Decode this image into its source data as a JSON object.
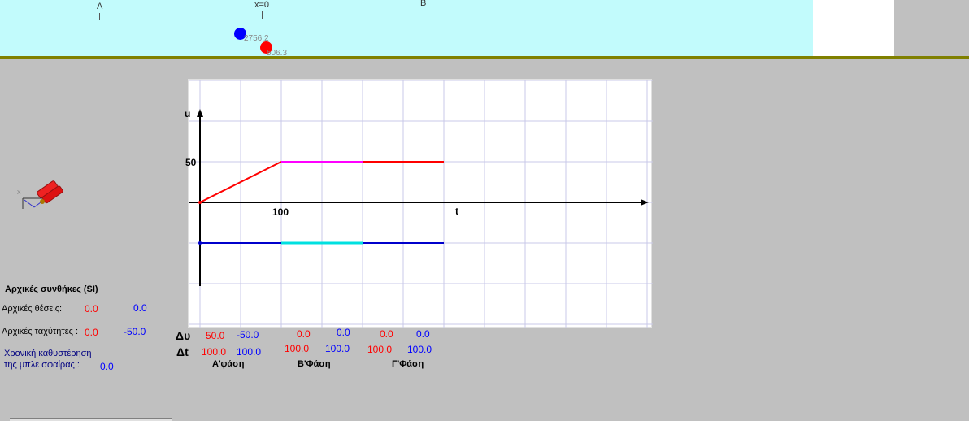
{
  "track": {
    "marker_a": "A",
    "marker_origin": "x=0",
    "marker_b": "B",
    "blue_ball_label": "2756.2",
    "red_ball_label": "506.3",
    "colors": {
      "track": "#c2fbfc",
      "ground": "#808000",
      "blue": "#0000ff",
      "red": "#ff0000"
    }
  },
  "graph": {
    "y_axis_label": "u",
    "x_axis_label": "t",
    "y_tick_label": "50",
    "x_tick_label": "100"
  },
  "chart_data": {
    "type": "line",
    "title": "",
    "xlabel": "t",
    "ylabel": "u",
    "grid": true,
    "series": [
      {
        "color": "#ff0000",
        "x": [
          0,
          100,
          200,
          300
        ],
        "y": [
          0,
          50,
          50,
          50
        ]
      },
      {
        "color": "#0000cc",
        "x": [
          0,
          100,
          200,
          300
        ],
        "y": [
          -50,
          -50,
          -50,
          -50
        ]
      }
    ],
    "phase_highlight_colors": {
      "red_phase_b": "#ff00ff",
      "blue_phase_b": "#00e0e0"
    }
  },
  "table": {
    "dv_symbol": "Δυ",
    "dt_symbol": "Δt",
    "phases": [
      {
        "label": "Α'φάση",
        "dv_red": "50.0",
        "dv_blue": "-50.0",
        "dt_red": "100.0",
        "dt_blue": "100.0"
      },
      {
        "label": "Β'Φάση",
        "dv_red": "0.0",
        "dv_blue": "0.0",
        "dt_red": "100.0",
        "dt_blue": "100.0"
      },
      {
        "label": "Γ'Φάση",
        "dv_red": "0.0",
        "dv_blue": "0.0",
        "dt_red": "100.0",
        "dt_blue": "100.0"
      }
    ]
  },
  "initial": {
    "header": "Αρχικές συνθήκες    (SI)",
    "positions_label": "Αρχικές  θέσεις:",
    "pos_red": "0.0",
    "pos_blue": "0.0",
    "velocities_label": "Αρχικές ταχύτητες :",
    "vel_red": "0.0",
    "vel_blue": "-50.0",
    "delay_label_1": "Χρονική καθυστέρηση",
    "delay_label_2": "της μπλε σφαίρας :",
    "delay_value": "0.0"
  },
  "icon": {
    "axis_letter": "x"
  }
}
